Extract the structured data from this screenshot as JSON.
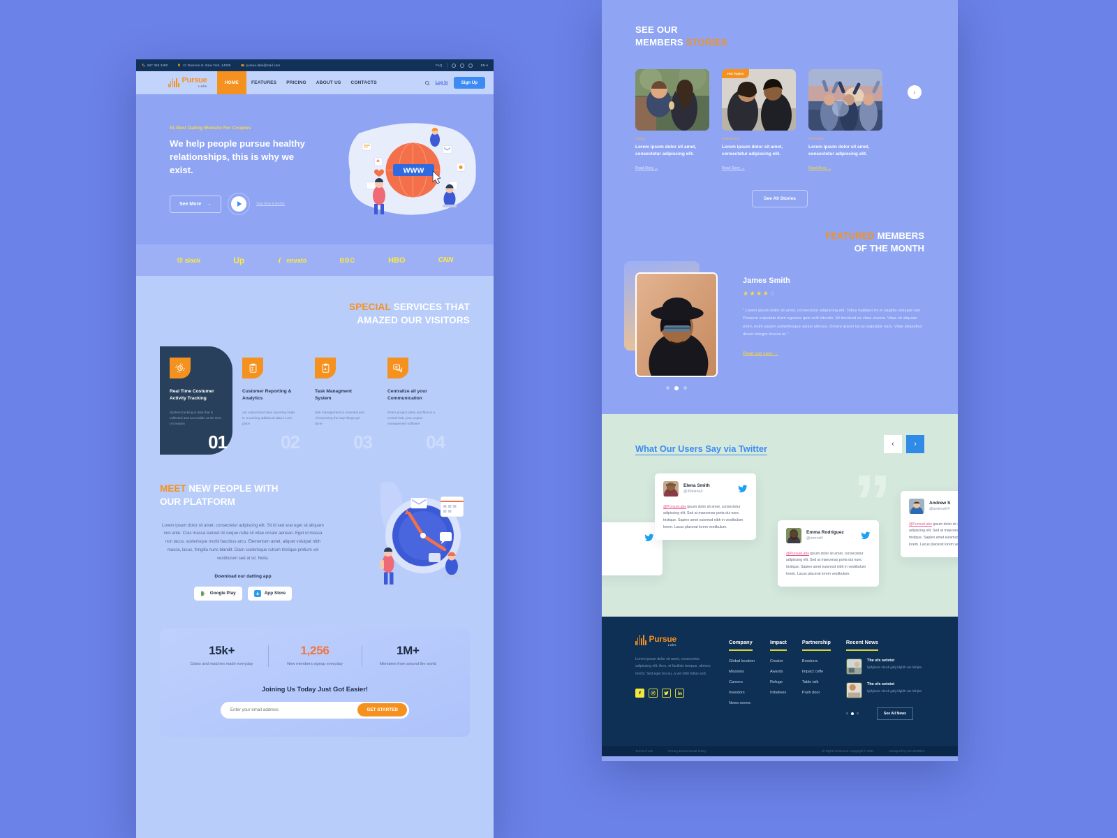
{
  "topbar": {
    "phone": "507 358 3490",
    "address": "21 Davison st. New York, 14005",
    "email": "pursue.labs@mail.com",
    "faq": "FAQ",
    "lang": "EN"
  },
  "nav": {
    "logo_name": "Pursue",
    "logo_sub": "Labs",
    "links": [
      {
        "label": "HOME",
        "active": true
      },
      {
        "label": "FEATURES",
        "active": false
      },
      {
        "label": "PRICING",
        "active": false
      },
      {
        "label": "ABOUT US",
        "active": false
      },
      {
        "label": "CONTACTS",
        "active": false
      }
    ],
    "login": "Log In",
    "signup": "Sign Up"
  },
  "hero": {
    "eyebrow": "#1 Best Dating Website For Couples",
    "title": "We help people pursue healthy relationships, this is why we exist.",
    "cta": "See More",
    "video_label": "See how it works"
  },
  "brands": [
    "slack",
    "Up",
    "envato",
    "BBC",
    "HBO",
    "CNN"
  ],
  "services": {
    "heading_accent": "SPECIAL",
    "heading_rest": " SERVICES THAT",
    "heading_line2": "AMAZED OUR VISITORS",
    "items": [
      {
        "num": "01",
        "title": "Real Time Costumer Activity Tracking",
        "desc": "System tracking is data that is collected and accessible at the time of creation",
        "icon": "activity-tracking-icon"
      },
      {
        "num": "02",
        "title": "Customer Reporting & Analytics",
        "desc": "our cutpomised saas reporting helps in crunching additional data in one place",
        "icon": "clipboard-check-icon"
      },
      {
        "num": "03",
        "title": "Task Managment System",
        "desc": "task management is essential part of improving the way things get done",
        "icon": "clipboard-chart-icon"
      },
      {
        "num": "04",
        "title": "Centralize all your Communication",
        "desc": "Share project plans and files in a central hub, your project management software",
        "icon": "chat-bubbles-icon"
      }
    ]
  },
  "meet": {
    "heading_accent": "MEET",
    "heading_rest": " NEW PEOPLE WITH",
    "heading_line2": "OUR PLATFORM",
    "body": "Lorem ipsum dolor sit amet, consectetur adipiscing elit. Sit id sed erat eget sit aliquam non ante. Cras massa laoreet mi neque nulla sit vitae ornare aenean. Eget id massa non lacus, scelerisque morbi faucibus arcu. Elementum amet, aliquet volutpat nibh massa, lacus, fringilla nunc blandit. Diam scelerisque rutrum tristique pretium vel vestibulum sed at sit. Nulla.",
    "download_label": "Download our datting app",
    "stores": [
      {
        "label": "Google Play",
        "icon": "google-play-icon"
      },
      {
        "label": "App Store",
        "icon": "app-store-icon"
      }
    ]
  },
  "stats": {
    "items": [
      {
        "number": "15k+",
        "label": "Dates and matches made everyday",
        "accent": false
      },
      {
        "number": "1,256",
        "label": "New members signup everyday",
        "accent": true
      },
      {
        "number": "1M+",
        "label": "Members from around the world",
        "accent": false
      }
    ],
    "join_title": "Joining Us Today Just Got Easier!",
    "email_placeholder": "Enter your email address",
    "submit": "GET STARTED"
  },
  "stories": {
    "heading_line1": "SEE OUR",
    "heading_line2": "MEMBERS ",
    "heading_accent": "STORIES",
    "items": [
      {
        "category": "Dating",
        "title": "Lorem ipsum dolor sit amet, consectetur adipiscing elit.",
        "link": "Read Story",
        "badge": null,
        "highlight": false
      },
      {
        "category": "Relationship",
        "title": "Lorem ipsum dolor sit amet, consectetur adipiscing elit.",
        "link": "Read Story",
        "badge": "Hot Topics",
        "highlight": false
      },
      {
        "category": "Friendship",
        "title": "Lorem ipsum dolor sit amet, consectetur adipiscing elit.",
        "link": "Read Story",
        "badge": null,
        "highlight": true
      }
    ],
    "see_all": "See All Stories"
  },
  "featured": {
    "heading_accent": "FEATURED",
    "heading_rest": " MEMBERS",
    "heading_line2": "OF THE MONTH",
    "name": "James Smith",
    "rating": 4,
    "rating_max": 5,
    "quote": "” Lorem ipsum dolor sit amet, consectetur adipiscing elit. Tellus habitant mi et sagittis volutpat non. Posuere vulputate diam egestas quis velit lobortis. Mi tincidunt ac vitae viverra. Vitae sit aliquam enim, enim sapien pellentesque varius ultrices. Ornare ipsum lacus vulputate nam. Vitae phasellus donec integer massa id. ”",
    "link": "Read use case",
    "active_dot": 2
  },
  "twitter": {
    "title": "What Our Users Say via Twitter",
    "prev": "‹",
    "next": "›",
    "tweets": [
      {
        "name": "Elena Smith",
        "handle": "@30elena3",
        "mention": "@PursueLabs",
        "body": " ipsum dolor sit amet, consectetur adipiscing elit. Sed at maecenas porta dui nunc tristique. Sapien amet euismod nibh in vestibulum lorem. Lacus placerat lorem vestibulum."
      },
      {
        "name": "Emma Rodriguez",
        "handle": "@emrod4",
        "mention": "@PursueLabs",
        "body": " ipsum dolor sit amet, consectetur adipiscing elit. Sed at maecenas porta dui nunc tristique. Sapien amet euismod nibh in vestibulum lorem. Lacus placerat lorem vestibulum."
      },
      {
        "name": "Andrew S",
        "handle": "@andrew04",
        "mention": "@PursueLabs",
        "body": " ipsum dolor sit amet, consectetur adipiscing elit. Sed at maecenas porta dui nunc tristique. Sapien amet euismod nibh in vestibulum lorem. Lacus placerat lorem vestibulum."
      }
    ]
  },
  "footer": {
    "logo_name": "Pursue",
    "logo_sub": "Labs",
    "desc": "Lorem ipsum dolor sit amet, consectetur adipiscing elit. Arcu, et facilisis tempus, ultrices morbi. Sed eget leo eu, a vel nibh tellus sed.",
    "socials": [
      "facebook-icon",
      "instagram-icon",
      "twitter-icon",
      "linkedin-icon"
    ],
    "columns": [
      {
        "title": "Company",
        "links": [
          "Global location",
          "Missions",
          "Careers",
          "Investors",
          "News rooms"
        ]
      },
      {
        "title": "Impact",
        "links": [
          "Creator",
          "Awards",
          "Refuge",
          "Initiatives"
        ]
      },
      {
        "title": "Partnership",
        "links": [
          "Brookers",
          "Impact coffe",
          "Table talk",
          "Push door"
        ]
      }
    ],
    "news_title": "Recent News",
    "news": [
      {
        "title": "The sfs setstst",
        "desc": "fghfghvbn vbnvb gdfg fdgfdh vdv hkhjkm"
      },
      {
        "title": "The sfs setstst",
        "desc": "fghfghvbn vbnvb gdfg fdgfdh vdv hkhjkm"
      }
    ],
    "see_news": "See All News",
    "bottom": {
      "terms": "Terms of use",
      "privacy": "Privacy Enviromental Policy",
      "rights": "All Rights Reserved. Copyright © 2021",
      "credit": "Designed by GC-WORKS"
    }
  },
  "colors": {
    "accent_orange": "#f5911e",
    "accent_blue": "#3d8bf2",
    "yellow": "#ffd83b",
    "dark_navy": "#0e3055",
    "panel_blue": "#8fa5f3"
  }
}
